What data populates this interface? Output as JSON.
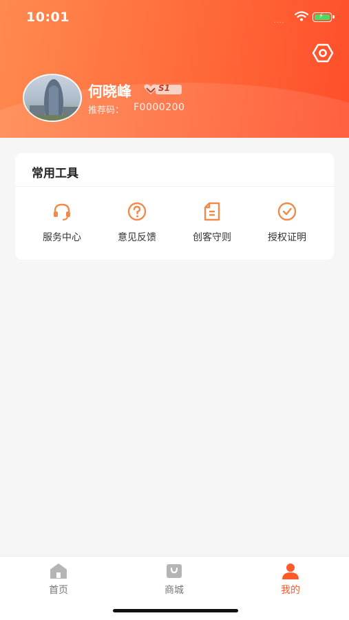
{
  "status": {
    "time": "10:01",
    "dots": "....",
    "wifi_icon": "wifi-icon",
    "battery_icon": "battery-charging-icon"
  },
  "profile": {
    "name": "何晓峰",
    "level": "S1",
    "referral_label": "推荐码：",
    "referral_code": "F0000200"
  },
  "tools": {
    "title": "常用工具",
    "items": [
      {
        "label": "服务中心",
        "icon": "headset-icon"
      },
      {
        "label": "意见反馈",
        "icon": "question-circle-icon"
      },
      {
        "label": "创客守则",
        "icon": "document-icon"
      },
      {
        "label": "授权证明",
        "icon": "check-circle-icon"
      }
    ]
  },
  "tabbar": {
    "items": [
      {
        "label": "首页",
        "icon": "home-icon"
      },
      {
        "label": "商城",
        "icon": "shop-bag-icon"
      },
      {
        "label": "我的",
        "icon": "user-icon"
      }
    ],
    "active": "我的"
  },
  "colors": {
    "accent": "#ff5a2a",
    "tool_icon": "#f08a4b"
  }
}
